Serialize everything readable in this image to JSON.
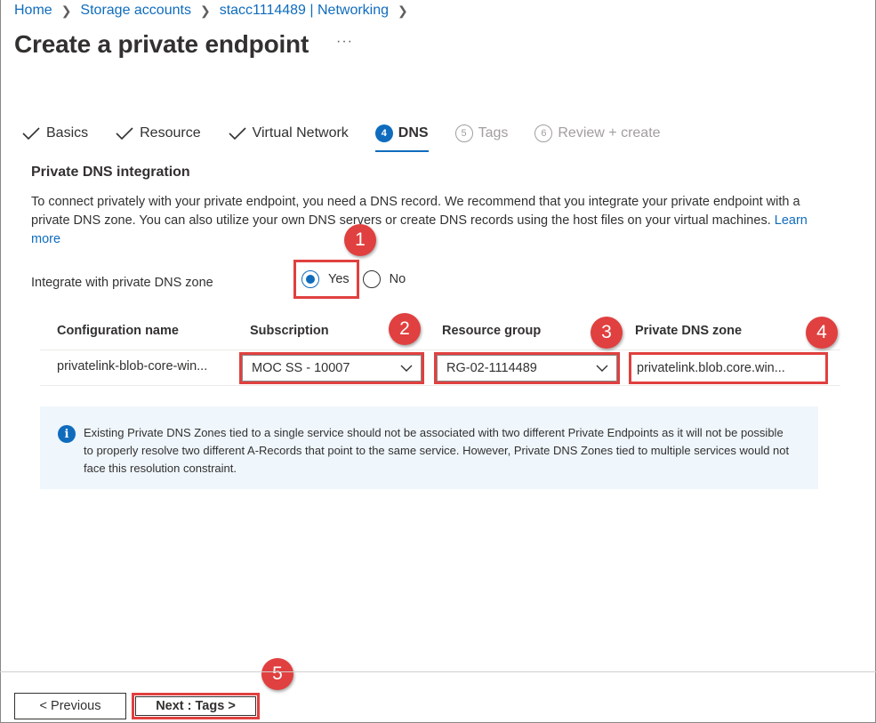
{
  "breadcrumb": {
    "items": [
      "Home",
      "Storage accounts",
      "stacc1114489 | Networking"
    ]
  },
  "page": {
    "title": "Create a private endpoint",
    "more": "···"
  },
  "tabs": [
    {
      "label": "Basics",
      "state": "done"
    },
    {
      "label": "Resource",
      "state": "done"
    },
    {
      "label": "Virtual Network",
      "state": "done"
    },
    {
      "label": "DNS",
      "state": "active",
      "number": "4"
    },
    {
      "label": "Tags",
      "state": "disabled",
      "number": "5"
    },
    {
      "label": "Review + create",
      "state": "disabled",
      "number": "6"
    }
  ],
  "section": {
    "title": "Private DNS integration",
    "description": "To connect privately with your private endpoint, you need a DNS record. We recommend that you integrate your private endpoint with a private DNS zone. You can also utilize your own DNS servers or create DNS records using the host files on your virtual machines.",
    "learn_more": "Learn more"
  },
  "integrate": {
    "label": "Integrate with private DNS zone",
    "yes": "Yes",
    "no": "No",
    "selected": "Yes"
  },
  "table": {
    "headers": [
      "Configuration name",
      "Subscription",
      "Resource group",
      "Private DNS zone"
    ],
    "row": {
      "config_name": "privatelink-blob-core-win...",
      "subscription": "MOC SS - 10007",
      "resource_group": "RG-02-1114489",
      "dns_zone": "privatelink.blob.core.win..."
    }
  },
  "info": {
    "icon": "info-icon",
    "text": "Existing Private DNS Zones tied to a single service should not be associated with two different Private Endpoints as it will not be possible to properly resolve two different A-Records that point to the same service. However, Private DNS Zones tied to multiple services would not face this resolution constraint."
  },
  "callouts": [
    "1",
    "2",
    "3",
    "4",
    "5"
  ],
  "buttons": {
    "previous": "< Previous",
    "next": "Next : Tags >"
  },
  "colors": {
    "accent": "#0f6cbd",
    "highlight": "#e0403f",
    "info_bg": "#eff6fc"
  }
}
